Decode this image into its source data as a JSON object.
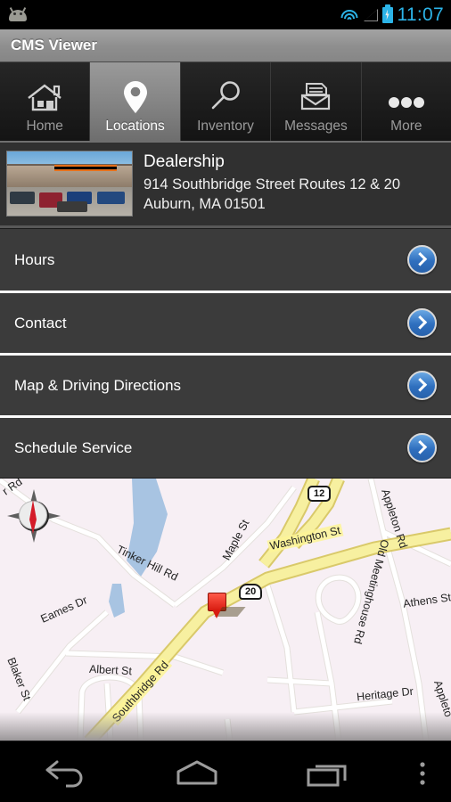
{
  "status_bar": {
    "notification_icon": "android-robot-icon",
    "wifi_icon": "wifi-icon",
    "signal_icon": "cellular-signal-icon",
    "battery_icon": "battery-charging-icon",
    "time": "11:07",
    "accent_color": "#2cb4e8"
  },
  "title_bar": {
    "title": "CMS Viewer"
  },
  "tabs": [
    {
      "label": "Home",
      "icon": "home-icon",
      "selected": false
    },
    {
      "label": "Locations",
      "icon": "map-pin-icon",
      "selected": true
    },
    {
      "label": "Inventory",
      "icon": "magnifier-icon",
      "selected": false
    },
    {
      "label": "Messages",
      "icon": "envelope-icon",
      "selected": false
    },
    {
      "label": "More",
      "icon": "ellipsis-icon",
      "selected": false
    }
  ],
  "location_header": {
    "thumbnail_alt": "harley-davidson-dealership-photo",
    "name": "Dealership",
    "address_line1": "914 Southbridge Street Routes 12 & 20",
    "address_line2": "Auburn, MA 01501"
  },
  "list_rows": [
    {
      "label": "Hours",
      "chevron": "chevron-right-icon"
    },
    {
      "label": "Contact",
      "chevron": "chevron-right-icon"
    },
    {
      "label": "Map & Driving Directions",
      "chevron": "chevron-right-icon"
    },
    {
      "label": "Schedule Service",
      "chevron": "chevron-right-icon"
    }
  ],
  "map": {
    "compass_icon": "compass-rose-icon",
    "marker_icon": "map-marker-pin-icon",
    "street_labels": [
      "Tinker Hill Rd",
      "Maple St",
      "Washington St",
      "Appleton Rd",
      "Athens St",
      "Eames Dr",
      "Albert St",
      "Blaker St",
      "Southbridge Rd",
      "Old Meetinghouse Rd",
      "Heritage Dr",
      "Appleto"
    ],
    "route_shields": [
      "12",
      "20"
    ],
    "partial_label_top_left": "r Rd",
    "highway_color": "#f5ee9e",
    "water_color": "#a8c4e2",
    "background_color": "#f7eff4"
  },
  "nav_bar": {
    "back": "back-icon",
    "home": "home-nav-icon",
    "recents": "recent-apps-icon",
    "menu": "overflow-menu-icon"
  }
}
